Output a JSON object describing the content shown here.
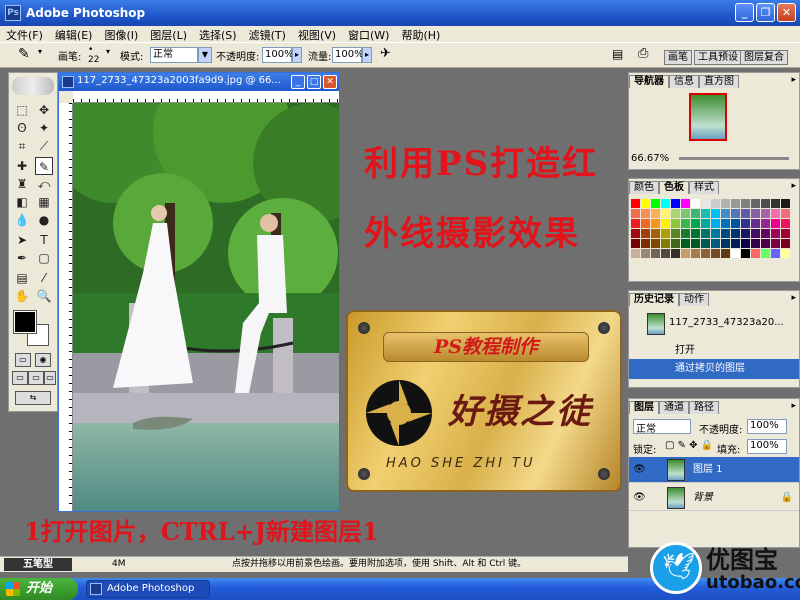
{
  "window": {
    "title": "Adobe Photoshop"
  },
  "menu": [
    "文件(F)",
    "编辑(E)",
    "图像(I)",
    "图层(L)",
    "选择(S)",
    "滤镜(T)",
    "视图(V)",
    "窗口(W)",
    "帮助(H)"
  ],
  "options": {
    "brush_label": "画笔:",
    "brush_size": "22",
    "mode_label": "模式:",
    "mode_value": "正常",
    "opacity_label": "不透明度:",
    "opacity_value": "100%",
    "flow_label": "流量:",
    "flow_value": "100%",
    "palette_tabs": [
      "画笔",
      "工具预设",
      "图层复合"
    ]
  },
  "document": {
    "title": "117_2733_47323a2003fa9d9.jpg @ 66..."
  },
  "overlay": {
    "headline_line1": "利用PS打造红",
    "headline_line2": "外线摄影效果",
    "step_text": "1打开图片，CTRL+J新建图层1"
  },
  "plaque": {
    "ribbon_text": "PS教程制作",
    "brand_cn": "好摄之徒",
    "brand_en": "HAO SHE ZHI TU"
  },
  "navigator": {
    "tabs": [
      "导航器",
      "信息",
      "直方图"
    ],
    "zoom": "66.67%"
  },
  "swatches": {
    "tabs": [
      "颜色",
      "色板",
      "样式"
    ],
    "colors": [
      "#ff0000",
      "#ffff00",
      "#00ff00",
      "#00ffff",
      "#0000ff",
      "#ff00ff",
      "#ffffff",
      "#e6e6e6",
      "#cccccc",
      "#b3b3b3",
      "#999999",
      "#808080",
      "#666666",
      "#4d4d4d",
      "#333333",
      "#1a1a1a",
      "#f26c4f",
      "#f68e55",
      "#fbaf5c",
      "#fff467",
      "#acd372",
      "#7cc576",
      "#3bb878",
      "#1abbb4",
      "#00bff3",
      "#438ccb",
      "#5574b9",
      "#605ca8",
      "#855fa8",
      "#a763a8",
      "#f06ea9",
      "#f26d7d",
      "#ed1c24",
      "#f26522",
      "#f7941d",
      "#fff200",
      "#8dc63f",
      "#39b54a",
      "#00a651",
      "#00a99d",
      "#00aeef",
      "#0072bc",
      "#0054a6",
      "#2e3192",
      "#662d91",
      "#92278f",
      "#ec008c",
      "#ed145b",
      "#9e0b0f",
      "#a0410d",
      "#a36209",
      "#aba000",
      "#598527",
      "#1a7b30",
      "#007236",
      "#00746b",
      "#0076a3",
      "#004b80",
      "#003471",
      "#1b1464",
      "#440e62",
      "#630460",
      "#9e005d",
      "#9e0039",
      "#790000",
      "#7b2e00",
      "#7d4900",
      "#827b00",
      "#406618",
      "#005e20",
      "#005826",
      "#005952",
      "#005b7f",
      "#003663",
      "#002157",
      "#0d004c",
      "#32004b",
      "#4b0049",
      "#7b0046",
      "#7a0026",
      "#c7b299",
      "#998675",
      "#736357",
      "#534741",
      "#37302a",
      "#c69c6d",
      "#a67c52",
      "#8c6239",
      "#754c24",
      "#603913",
      "#ffffff",
      "#000000",
      "#ff6666",
      "#66ff66",
      "#6666ff",
      "#ffff99"
    ]
  },
  "history": {
    "tabs": [
      "历史记录",
      "动作"
    ],
    "snapshot": "117_2733_47323a20...",
    "items": [
      "打开",
      "通过拷贝的图层"
    ]
  },
  "layers": {
    "tabs": [
      "图层",
      "通道",
      "路径"
    ],
    "blend_mode": "正常",
    "opacity_label": "不透明度:",
    "opacity_value": "100%",
    "lock_label": "锁定:",
    "fill_label": "填充:",
    "fill_value": "100%",
    "items": [
      "图层 1",
      "背景"
    ]
  },
  "status": {
    "zoom_tab": "五笔型",
    "doc_size": "4M",
    "hint": "点按并拖移以用前景色绘画。要用附加选项，使用 Shift、Alt 和 Ctrl 键。"
  },
  "taskbar": {
    "start_label": "开始",
    "task_item": "Adobe Photoshop"
  },
  "watermark": {
    "cn": "优图宝",
    "en": "utobao.com"
  }
}
